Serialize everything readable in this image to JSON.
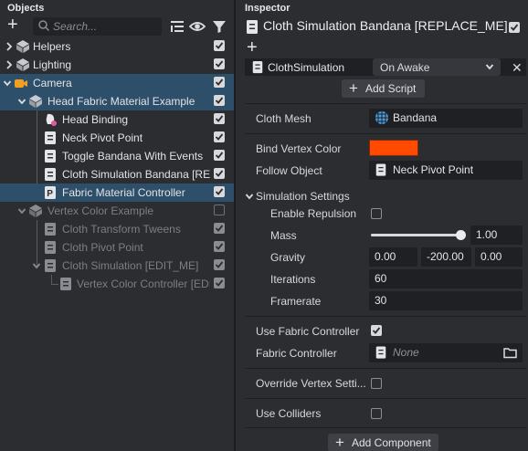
{
  "objects": {
    "title": "Objects",
    "search_placeholder": "Search...",
    "rows": [
      {
        "label": "Helpers"
      },
      {
        "label": "Lighting"
      },
      {
        "label": "Camera"
      },
      {
        "label": "Head Fabric Material Example"
      },
      {
        "label": "Head Binding"
      },
      {
        "label": "Neck Pivot Point"
      },
      {
        "label": "Toggle Bandana With Events"
      },
      {
        "label": "Cloth Simulation Bandana [REPLACE_ME]"
      },
      {
        "label": "Fabric Material Controller"
      },
      {
        "label": "Vertex Color Example"
      },
      {
        "label": "Cloth Transform Tweens"
      },
      {
        "label": "Cloth Pivot Point"
      },
      {
        "label": "Cloth Simulation [EDIT_ME]"
      },
      {
        "label": "Vertex Color Controller [EDIT_ME]"
      }
    ]
  },
  "inspector": {
    "title": "Inspector",
    "object_name": "Cloth Simulation Bandana [REPLACE_ME]",
    "component": {
      "name": "ClothSimulation",
      "trigger": "On Awake"
    },
    "add_script": "Add Script",
    "fields": {
      "cloth_mesh": {
        "label": "Cloth Mesh",
        "value": "Bandana"
      },
      "bind_vertex_color": {
        "label": "Bind Vertex Color",
        "color": "#ff4a00"
      },
      "follow_object": {
        "label": "Follow Object",
        "value": "Neck Pivot Point"
      },
      "simulation_settings": "Simulation Settings",
      "enable_repulsion": {
        "label": "Enable Repulsion",
        "checked": false
      },
      "mass": {
        "label": "Mass",
        "value": "1.00",
        "fraction": 1.0
      },
      "gravity": {
        "label": "Gravity",
        "x": "0.00",
        "y": "-200.00",
        "z": "0.00"
      },
      "iterations": {
        "label": "Iterations",
        "value": "60"
      },
      "framerate": {
        "label": "Framerate",
        "value": "30"
      },
      "use_fabric_controller": {
        "label": "Use Fabric Controller",
        "checked": true
      },
      "fabric_controller": {
        "label": "Fabric Controller",
        "value": "None"
      },
      "override_vertex": {
        "label": "Override Vertex Setti...",
        "checked": false
      },
      "use_colliders": {
        "label": "Use Colliders",
        "checked": false
      }
    },
    "add_component": "Add Component"
  },
  "colors": {
    "selection": "#2d4f6a",
    "accent_orange": "#ff4a00",
    "camera_icon": "#f0a020"
  }
}
